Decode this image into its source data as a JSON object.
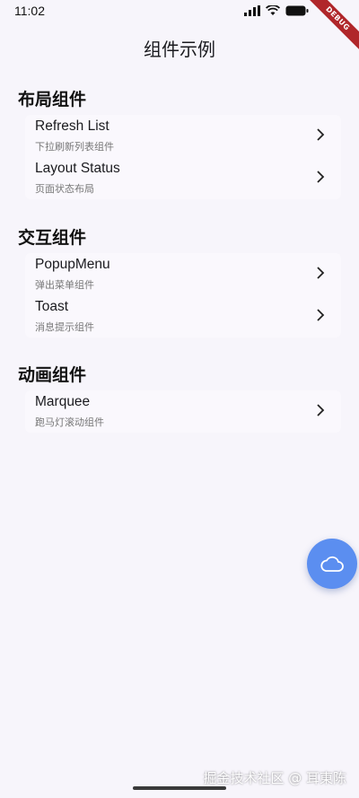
{
  "status": {
    "time": "11:02",
    "ribbon": "DEBUG"
  },
  "app_bar": {
    "title": "组件示例"
  },
  "sections": [
    {
      "title": "布局组件",
      "items": [
        {
          "title": "Refresh List",
          "subtitle": "下拉刷新列表组件"
        },
        {
          "title": "Layout Status",
          "subtitle": "页面状态布局"
        }
      ]
    },
    {
      "title": "交互组件",
      "items": [
        {
          "title": "PopupMenu",
          "subtitle": "弹出菜单组件"
        },
        {
          "title": "Toast",
          "subtitle": "消息提示组件"
        }
      ]
    },
    {
      "title": "动画组件",
      "items": [
        {
          "title": "Marquee",
          "subtitle": "跑马灯滚动组件"
        }
      ]
    }
  ],
  "fab": {
    "icon": "cloud-icon",
    "color": "#5b8ef0"
  },
  "watermark": "掘金技术社区 @ 耳東陈"
}
